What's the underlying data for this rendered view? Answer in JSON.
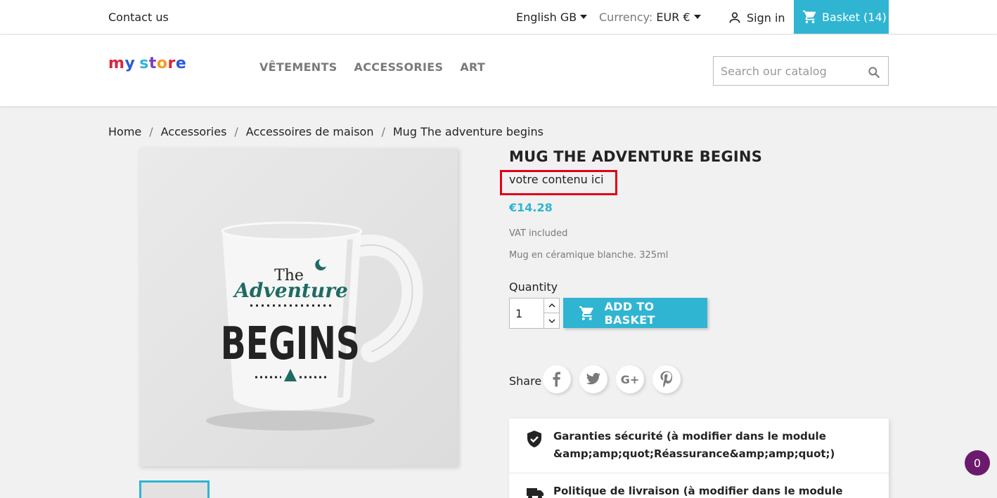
{
  "topbar": {
    "contact": "Contact us",
    "language": "English GB",
    "currency_label": "Currency:",
    "currency_value": "EUR €",
    "signin": "Sign in",
    "basket": "Basket (14)"
  },
  "header": {
    "logo_text": "my store",
    "nav": [
      "VÊTEMENTS",
      "ACCESSORIES",
      "ART"
    ],
    "search_placeholder": "Search our catalog"
  },
  "breadcrumb": [
    "Home",
    "Accessories",
    "Accessoires de maison",
    "Mug The adventure begins"
  ],
  "breadcrumb_separator": "/",
  "product": {
    "title": "MUG THE ADVENTURE BEGINS",
    "custom_text": "votre contenu ici",
    "price": "€14.28",
    "vat": "VAT included",
    "short_description": "Mug en céramique blanche. 325ml",
    "quantity_label": "Quantity",
    "quantity_value": "1",
    "add_to_basket": "ADD TO BASKET",
    "image_text": {
      "the": "The",
      "adventure": "Adventure",
      "begins": "BEGINS"
    }
  },
  "share": {
    "label": "Share",
    "networks": [
      "facebook",
      "twitter",
      "google-plus",
      "pinterest"
    ]
  },
  "reassurance": [
    {
      "icon": "shield-check-icon",
      "text": "Garanties sécurité (à modifier dans le module &amp;amp;quot;Réassurance&amp;amp;quot;)"
    },
    {
      "icon": "truck-icon",
      "text": "Politique de livraison (à modifier dans le module"
    }
  ],
  "floating_counter": "0",
  "colors": {
    "accent": "#2fb5d2",
    "highlight_border": "#e2001a",
    "counter_bg": "#6b1a6d",
    "mug_teal": "#1f6b63"
  }
}
